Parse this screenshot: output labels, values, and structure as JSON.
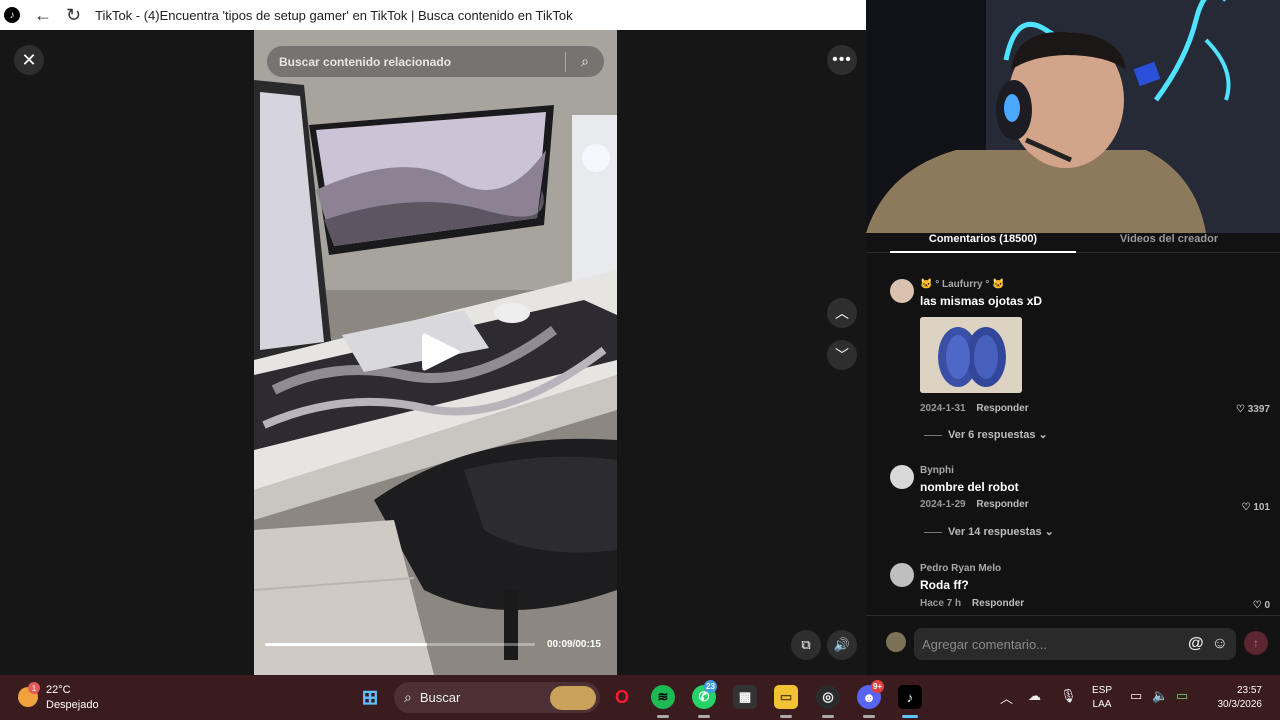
{
  "browser": {
    "title": "TikTok - (4)Encuentra 'tipos de setup gamer' en TikTok | Busca contenido en TikTok",
    "back_icon": "arrow-left-icon",
    "reload_icon": "reload-icon"
  },
  "player": {
    "search_placeholder": "Buscar contenido relacionado",
    "timecode": "00:09/00:15",
    "progress": 0.6
  },
  "panel": {
    "tabs": [
      "Comentarios (18500)",
      "Videos del creador"
    ],
    "comments": [
      {
        "author": "🐱 ° Laufurry ° 🐱",
        "text": "las mismas ojotas xD",
        "date": "2024-1-31",
        "reply": "Responder",
        "likes": "3397",
        "replies": "Ver 6 respuestas"
      },
      {
        "author": "Bynphi",
        "text": "nombre del robot",
        "date": "2024-1-29",
        "reply": "Responder",
        "likes": "101",
        "replies": "Ver 14 respuestas"
      },
      {
        "author": "Pedro Ryan Melo",
        "text": "Roda ff?",
        "date": "Hace 7 h",
        "reply": "Responder",
        "likes": "0"
      }
    ],
    "composer_placeholder": "Agregar comentario..."
  },
  "taskbar": {
    "weather_temp": "22°C",
    "weather_desc": "Despejado",
    "weather_badge": "1",
    "search_label": "Buscar",
    "whatsapp_badge": "23",
    "discord_badge": "9+",
    "lang_top": "ESP",
    "lang_bottom": "LAA",
    "time": "23:57",
    "date": "30/3/2026"
  }
}
